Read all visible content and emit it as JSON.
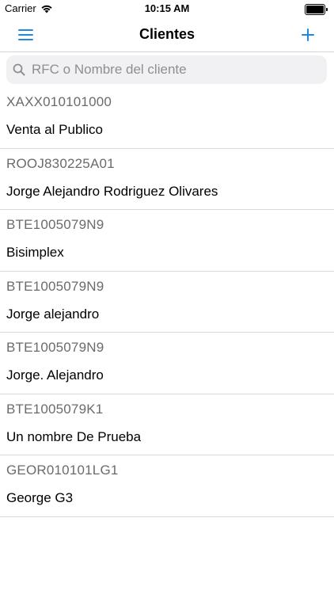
{
  "status_bar": {
    "carrier": "Carrier",
    "time": "10:15 AM"
  },
  "nav": {
    "title": "Clientes",
    "menu_icon": "hamburger-menu-icon",
    "add_icon": "plus-icon",
    "accent_color": "#1e88e5"
  },
  "search": {
    "placeholder": "RFC o Nombre del cliente",
    "value": "",
    "icon": "search-icon"
  },
  "clients": [
    {
      "rfc": "XAXX010101000",
      "name": "Venta al Publico"
    },
    {
      "rfc": "ROOJ830225A01",
      "name": "Jorge Alejandro Rodriguez Olivares"
    },
    {
      "rfc": "BTE1005079N9",
      "name": "Bisimplex"
    },
    {
      "rfc": "BTE1005079N9",
      "name": "Jorge alejandro"
    },
    {
      "rfc": "BTE1005079N9",
      "name": "Jorge. Alejandro"
    },
    {
      "rfc": "BTE1005079K1",
      "name": "Un nombre De Prueba"
    },
    {
      "rfc": "GEOR010101LG1",
      "name": "George G3"
    }
  ]
}
